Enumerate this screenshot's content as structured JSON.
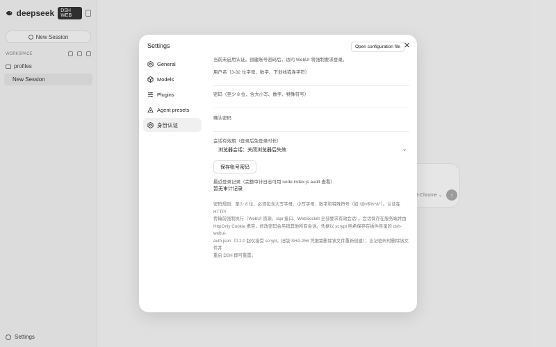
{
  "sidebar": {
    "brand": "deepseek",
    "brand_badge": "DSH WEB",
    "new_session": "New Session",
    "workspace_label": "WORKSPACE",
    "folder": "profiles",
    "session": "New Session",
    "settings": "Settings"
  },
  "composer": {
    "model": "DS-Chrome ⌄",
    "send_icon": "arrow-up"
  },
  "modal": {
    "title": "Settings",
    "open_config": "Open configuration file",
    "close_symbol": "✕",
    "nav": [
      {
        "label": "General",
        "icon": "hexagon-gear"
      },
      {
        "label": "Models",
        "icon": "cube"
      },
      {
        "label": "Plugins",
        "icon": "sliders"
      },
      {
        "label": "Agent presets",
        "icon": "recycle"
      },
      {
        "label": "身份认证",
        "icon": "hexagon-gear"
      }
    ]
  },
  "auth": {
    "note": "当前未启用认证。创建账号密码后，访问 WebUI 将强制要求登录。",
    "username_label": "用户名（3-32 位字母、数字、下划线或连字符）",
    "password_label": "密码（至少 8 位，含大小写、数字、特殊符号）",
    "confirm_label": "确认密码",
    "session_label": "会话有效期（登录后免登录时长）",
    "session_value": "浏览器会话：关闭浏览器后失效",
    "save_button": "保存账号密码",
    "audit_label": "最近登录记录（完整审计日志可用 node index.js audit 查看）",
    "audit_empty": "暂无审计记录",
    "rules_lines": [
      "密码规则：至少 8 位，必须包含大写字母、小写字母、数字和特殊符号（如 !@#$%^&*）。认证在 HTTP/",
      "传输前强制执行（WebUI 资源、/api 接口、WebSocket 全部要求有效会话）。会话保存在服务端并由",
      "HttpOnly Cookie 携带，修改密码会吊销其他所有会话。凭据以 scrypt 哈希保存在插件目录的 dsh-webui-",
      "auth.json（0.2.0 起仅接受 scrypt，旧版 SHA-256 凭据需删除该文件重新创建）；忘记密码时删除该文件并",
      "重启 DSH 即可重置。"
    ]
  }
}
